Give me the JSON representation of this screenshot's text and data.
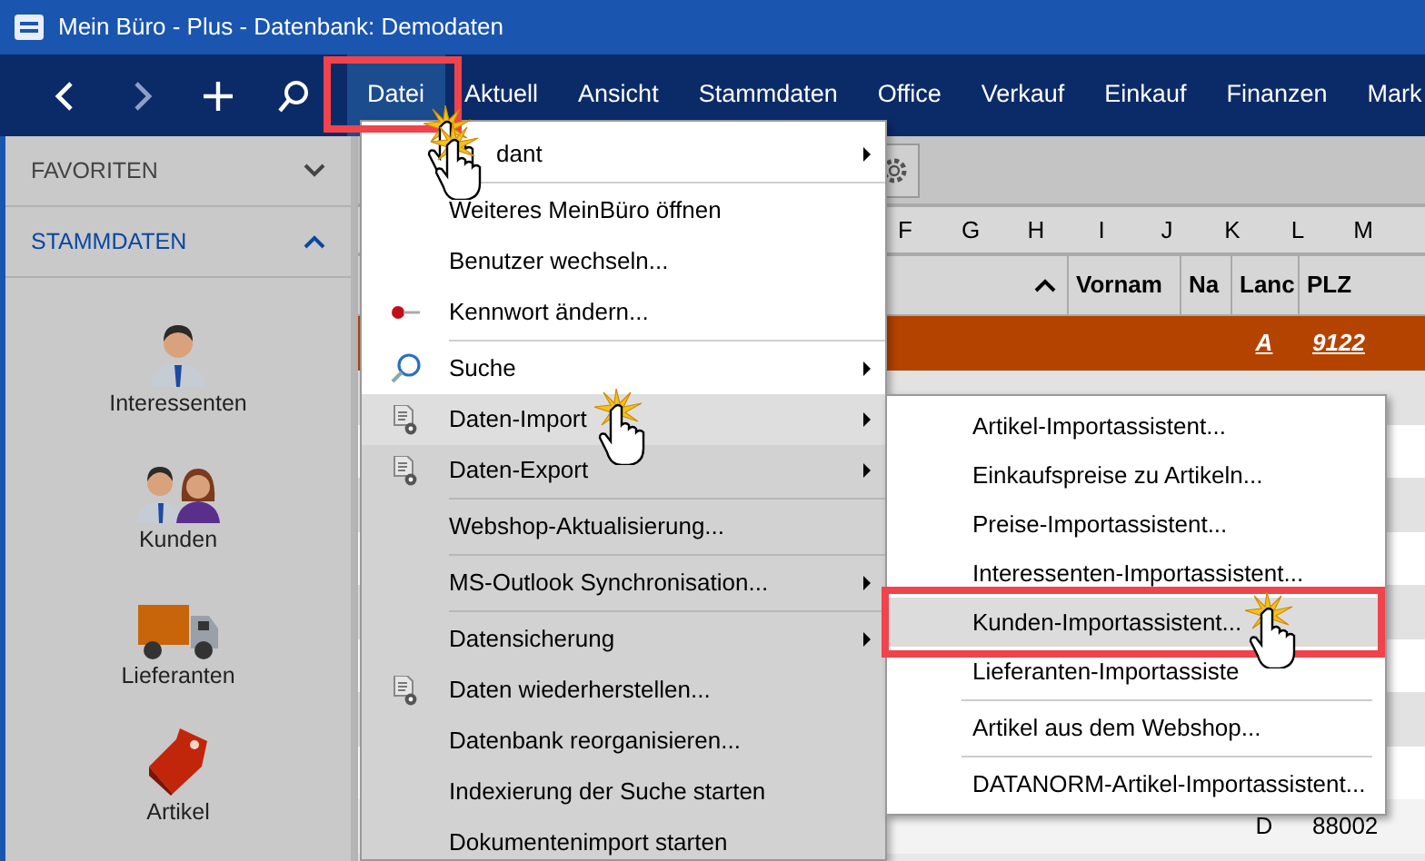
{
  "window": {
    "title": "Mein Büro - Plus - Datenbank: Demodaten"
  },
  "menubar": [
    {
      "label": "Datei",
      "selected": true,
      "highlighted": true,
      "pointer": true
    },
    {
      "label": "Aktuell",
      "selected": false,
      "highlighted": false,
      "pointer": false
    },
    {
      "label": "Ansicht",
      "selected": false,
      "highlighted": false,
      "pointer": false
    },
    {
      "label": "Stammdaten",
      "selected": false,
      "highlighted": false,
      "pointer": false
    },
    {
      "label": "Office",
      "selected": false,
      "highlighted": false,
      "pointer": false
    },
    {
      "label": "Verkauf",
      "selected": false,
      "highlighted": false,
      "pointer": false
    },
    {
      "label": "Einkauf",
      "selected": false,
      "highlighted": false,
      "pointer": false
    },
    {
      "label": "Finanzen",
      "selected": false,
      "highlighted": false,
      "pointer": false
    },
    {
      "label": "Mark",
      "selected": false,
      "highlighted": false,
      "pointer": false
    }
  ],
  "sidebar": {
    "sections": [
      {
        "label": "FAVORITEN",
        "expanded": false
      },
      {
        "label": "STAMMDATEN",
        "expanded": true
      }
    ],
    "items": [
      {
        "label": "Interessenten",
        "kind": "person"
      },
      {
        "label": "Kunden",
        "kind": "people"
      },
      {
        "label": "Lieferanten",
        "kind": "truck"
      },
      {
        "label": "Artikel",
        "kind": "tag"
      }
    ]
  },
  "grid": {
    "column_letters": [
      "F",
      "G",
      "H",
      "I",
      "J",
      "K",
      "L",
      "M"
    ],
    "columns": [
      {
        "label": "Vornam"
      },
      {
        "label": "Na"
      },
      {
        "label": "Lanc"
      },
      {
        "label": "PLZ"
      }
    ],
    "rows": [
      {
        "cells": [
          "",
          "",
          "A",
          "9122"
        ],
        "selected": true
      },
      {
        "cells": [
          "",
          "",
          "D",
          "88002"
        ],
        "selected": false
      }
    ]
  },
  "file_menu": {
    "items": [
      {
        "kind": "plain",
        "label": "dant",
        "submenu": true,
        "selected": false,
        "dimmed": false,
        "pointer": true
      },
      {
        "kind": "separator"
      },
      {
        "kind": "plain",
        "label": "Weiteres MeinBüro öffnen",
        "submenu": false,
        "selected": false,
        "dimmed": false,
        "pointer": false
      },
      {
        "kind": "plain",
        "label": "Benutzer wechseln...",
        "submenu": false,
        "selected": false,
        "dimmed": false,
        "pointer": false
      },
      {
        "kind": "key",
        "label": "Kennwort ändern...",
        "submenu": false,
        "selected": false,
        "dimmed": false,
        "pointer": false
      },
      {
        "kind": "separator"
      },
      {
        "kind": "search",
        "label": "Suche",
        "submenu": true,
        "selected": false,
        "dimmed": false,
        "pointer": false
      },
      {
        "kind": "document",
        "label": "Daten-Import",
        "submenu": true,
        "selected": true,
        "dimmed": false,
        "pointer": true
      },
      {
        "kind": "document",
        "label": "Daten-Export",
        "submenu": true,
        "selected": false,
        "dimmed": true,
        "pointer": false
      },
      {
        "kind": "separator"
      },
      {
        "kind": "plain",
        "label": "Webshop-Aktualisierung...",
        "submenu": false,
        "selected": false,
        "dimmed": true,
        "pointer": false
      },
      {
        "kind": "separator"
      },
      {
        "kind": "plain",
        "label": "MS-Outlook Synchronisation...",
        "submenu": true,
        "selected": false,
        "dimmed": true,
        "pointer": false
      },
      {
        "kind": "separator"
      },
      {
        "kind": "plain",
        "label": "Datensicherung",
        "submenu": true,
        "selected": false,
        "dimmed": true,
        "pointer": false
      },
      {
        "kind": "document",
        "label": "Daten wiederherstellen...",
        "submenu": false,
        "selected": false,
        "dimmed": true,
        "pointer": false
      },
      {
        "kind": "plain",
        "label": "Datenbank reorganisieren...",
        "submenu": false,
        "selected": false,
        "dimmed": true,
        "pointer": false
      },
      {
        "kind": "plain",
        "label": "Indexierung der Suche starten",
        "submenu": false,
        "selected": false,
        "dimmed": true,
        "pointer": false
      },
      {
        "kind": "plain",
        "label": "Dokumentenimport starten",
        "submenu": false,
        "selected": false,
        "dimmed": true,
        "pointer": false
      }
    ]
  },
  "import_submenu": {
    "items": [
      {
        "kind": "item",
        "label": "Artikel-Importassistent...",
        "selected": false,
        "highlighted": false,
        "pointer": false
      },
      {
        "kind": "item",
        "label": "Einkaufspreise zu Artikeln...",
        "selected": false,
        "highlighted": false,
        "pointer": false
      },
      {
        "kind": "item",
        "label": "Preise-Importassistent...",
        "selected": false,
        "highlighted": false,
        "pointer": false
      },
      {
        "kind": "item",
        "label": "Interessenten-Importassistent...",
        "selected": false,
        "highlighted": false,
        "pointer": false
      },
      {
        "kind": "item",
        "label": "Kunden-Importassistent...",
        "selected": true,
        "highlighted": true,
        "pointer": true
      },
      {
        "kind": "item",
        "label": "Lieferanten-Importassiste",
        "selected": false,
        "highlighted": false,
        "pointer": false
      },
      {
        "kind": "separator"
      },
      {
        "kind": "item",
        "label": "Artikel aus dem Webshop...",
        "selected": false,
        "highlighted": false,
        "pointer": false
      },
      {
        "kind": "separator"
      },
      {
        "kind": "item",
        "label": "DATANORM-Artikel-Importassistent...",
        "selected": false,
        "highlighted": false,
        "pointer": false
      }
    ]
  }
}
